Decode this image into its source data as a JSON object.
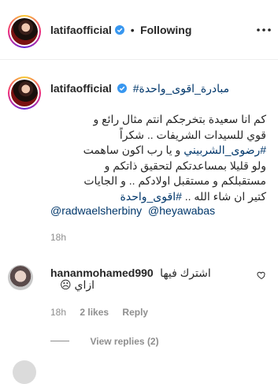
{
  "header": {
    "username": "latifaofficial",
    "separator": "•",
    "follow_status": "Following",
    "more_icon": "more-horizontal-icon"
  },
  "caption": {
    "username": "latifaofficial",
    "hashtag_1": "#مبادرة_اقوى_واحدة",
    "line_1": "كم انا سعيدة بتخرجكم انتم مثال رائع و",
    "line_2": "قوي للسيدات الشريفات .. شكراً",
    "hashtag_2": "#رضوى_الشربيني",
    "line_3_rest": " و يا رب اكون ساهمت",
    "line_4": "ولو قليلا بمساعدتكم لتحقيق ذاتكم و",
    "line_5": "مستقبلكم و مستقبل اولادكم .. و الجايات",
    "line_6_text": "كتير ان شاء الله .. ",
    "hashtag_3": "#اقوى_واحدة",
    "mention_1": "@radwaelsherbiny",
    "mention_2": "@heyawabas",
    "time": "18h"
  },
  "comment": {
    "username": "hananmohamed990",
    "text_line_1": "اشترك فيها",
    "text_line_2": "ازاي ☹",
    "time": "18h",
    "likes": "2 likes",
    "reply": "Reply",
    "view_replies": "View replies (2)"
  },
  "colors": {
    "link": "#00376b",
    "verified": "#3897f0",
    "muted": "#8e8e8e"
  }
}
